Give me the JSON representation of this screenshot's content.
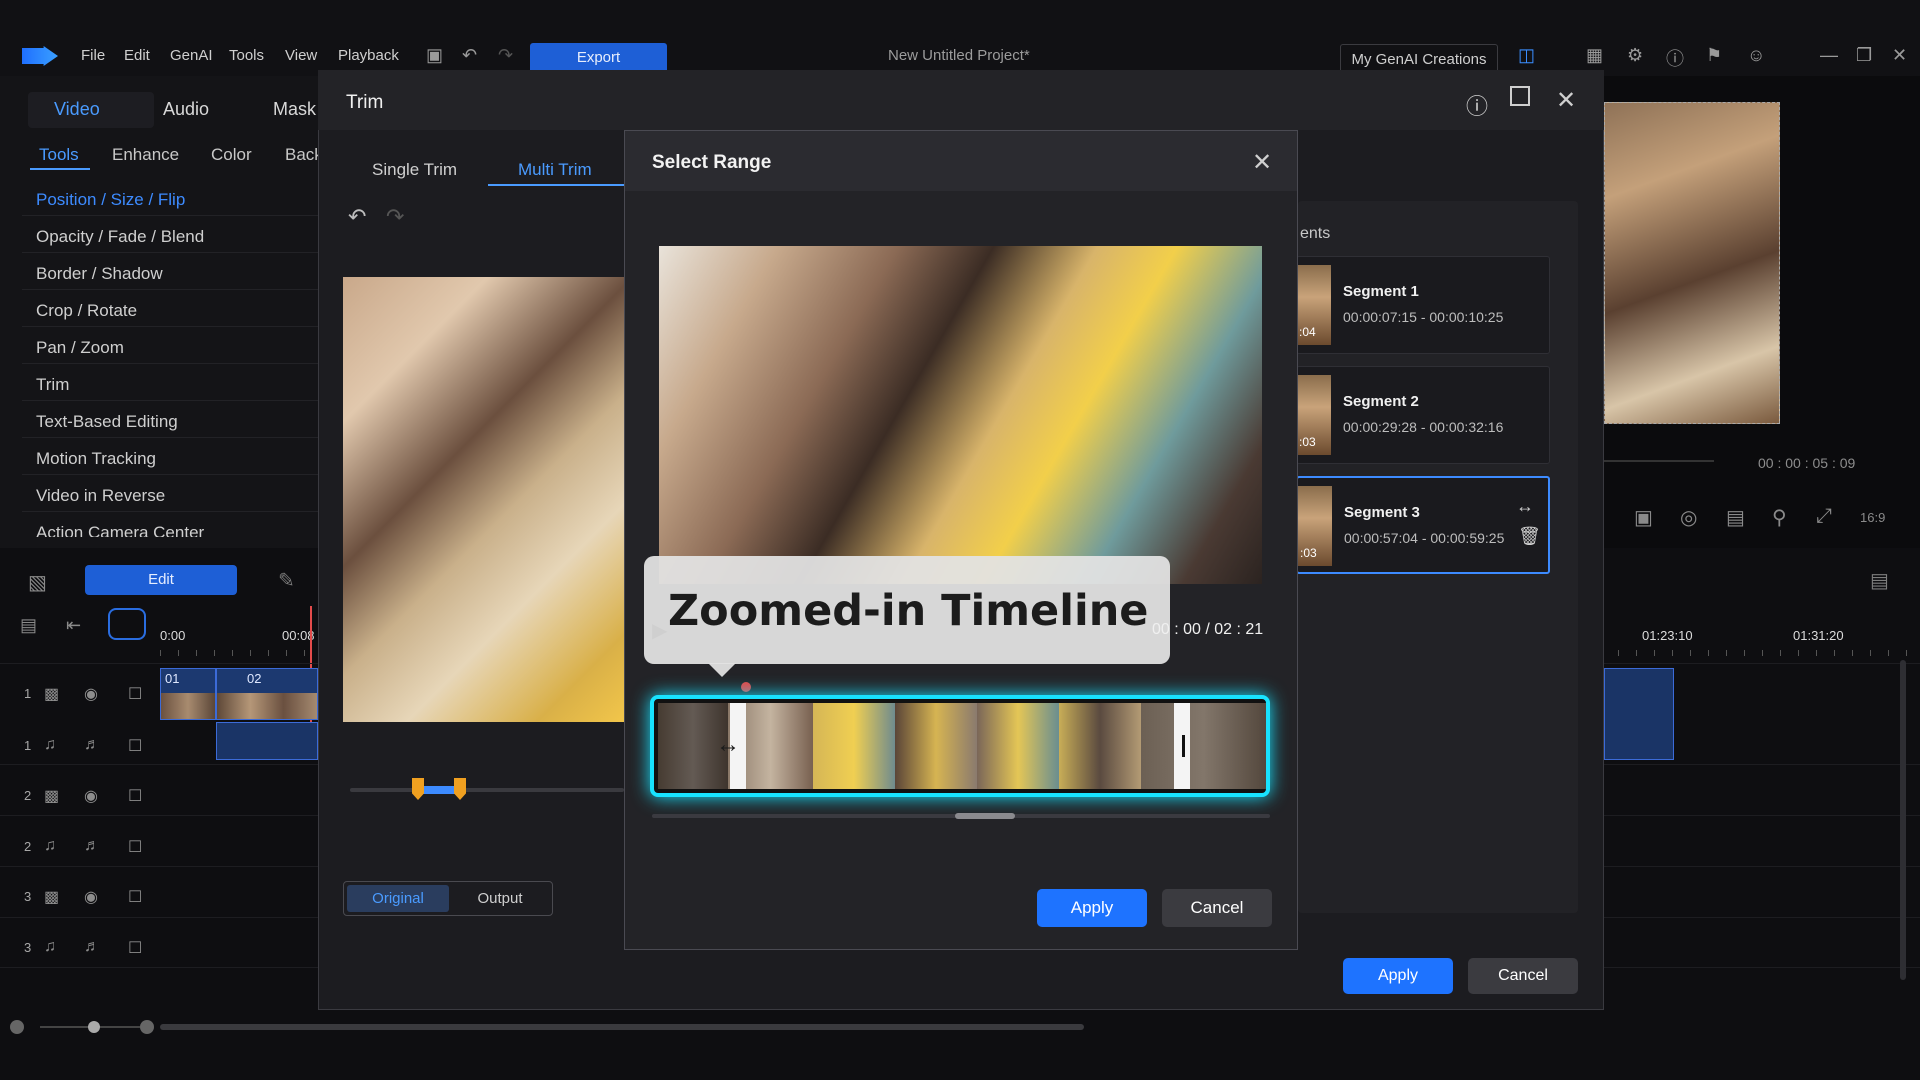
{
  "app": {
    "menu": [
      "File",
      "Edit",
      "GenAI",
      "Tools",
      "View",
      "Playback"
    ],
    "export_label": "Export",
    "project_title": "New Untitled Project*",
    "genai_creations_label": "My GenAI Creations"
  },
  "left_panel": {
    "main_tabs": [
      "Video",
      "Audio",
      "Mask"
    ],
    "sub_tabs": [
      "Tools",
      "Enhance",
      "Color",
      "Back"
    ],
    "tools": [
      "Position / Size / Flip",
      "Opacity / Fade / Blend",
      "Border / Shadow",
      "Crop / Rotate",
      "Pan / Zoom",
      "Trim",
      "Text-Based Editing",
      "Motion Tracking",
      "Video in Reverse",
      "Action Camera Center"
    ],
    "edit_button": "Edit"
  },
  "timeline": {
    "ruler": [
      "0:00",
      "00:08",
      "01:23:10",
      "01:31:20"
    ],
    "tracks": [
      "1",
      "1",
      "2",
      "2",
      "3",
      "3"
    ],
    "clip_labels": [
      "01",
      "02"
    ]
  },
  "preview": {
    "timecode": "00 : 00 : 05 : 09"
  },
  "trim_dialog": {
    "title": "Trim",
    "tabs": [
      "Single Trim",
      "Multi Trim"
    ],
    "active_tab": "Multi Trim",
    "view_toggle": [
      "Original",
      "Output"
    ],
    "segments_header": "ents",
    "segments": [
      {
        "name": "Segment 1",
        "range": "00:00:07:15 - 00:00:10:25",
        "thumb_label": ":04"
      },
      {
        "name": "Segment 2",
        "range": "00:00:29:28 - 00:00:32:16",
        "thumb_label": ":03"
      },
      {
        "name": "Segment 3",
        "range": "00:00:57:04 - 00:00:59:25",
        "thumb_label": ":03"
      }
    ],
    "apply_label": "Apply",
    "cancel_label": "Cancel"
  },
  "select_range": {
    "title": "Select Range",
    "overlay_caption": "Zoomed-in Timeline",
    "time_display": "00 : 00 / 02 : 21",
    "apply_label": "Apply",
    "cancel_label": "Cancel"
  },
  "colors": {
    "accent": "#1e73ff",
    "timeline_glow": "#18e3ff",
    "active_tab": "#4a9bff"
  }
}
